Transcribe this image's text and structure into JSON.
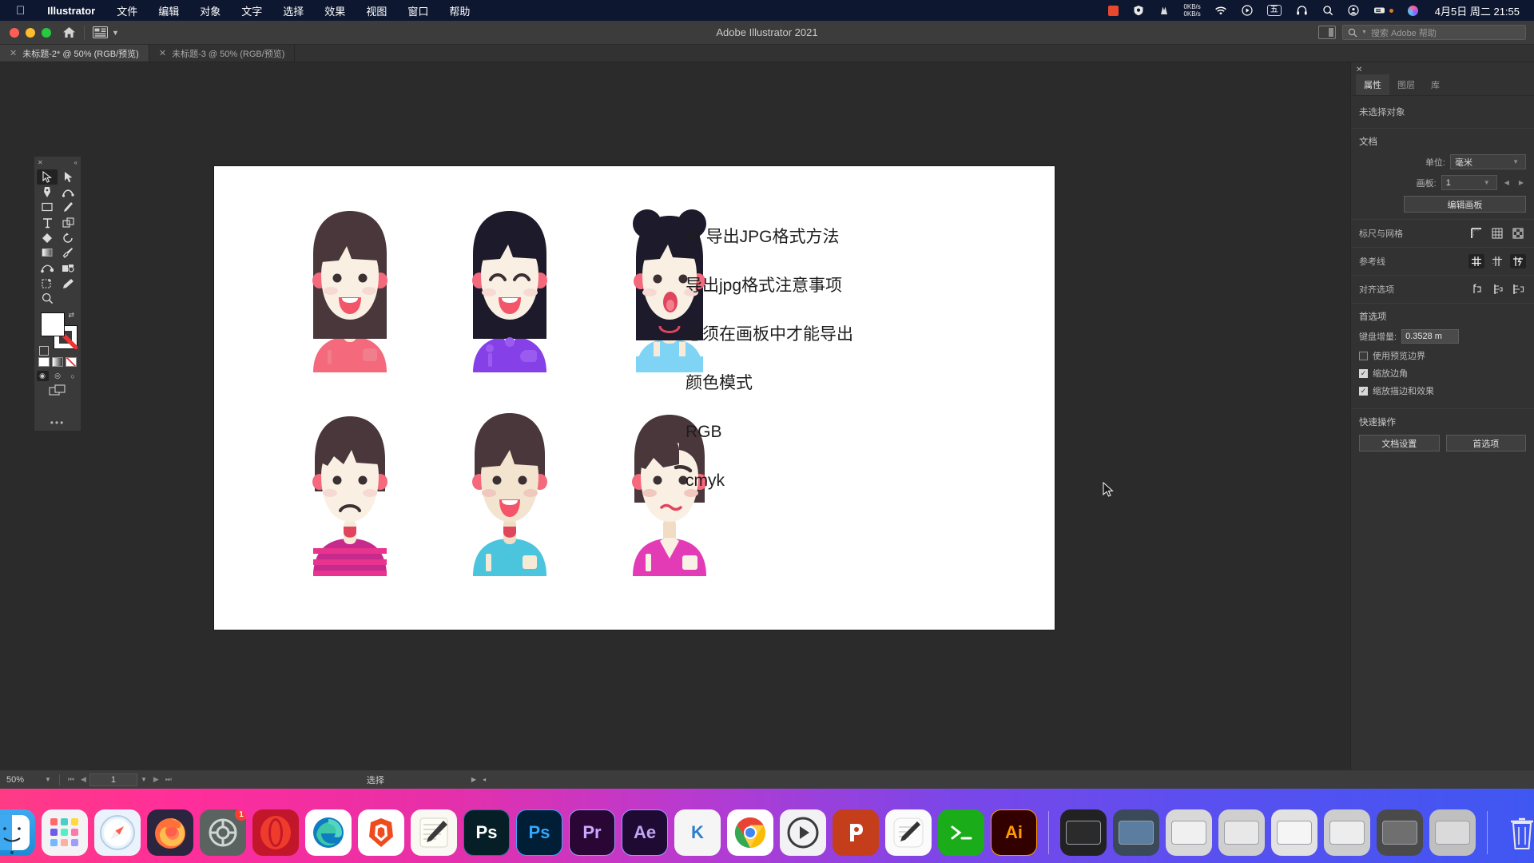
{
  "menubar": {
    "apple_icon": "apple-icon",
    "app_name": "Illustrator",
    "items": [
      "文件",
      "编辑",
      "对象",
      "文字",
      "选择",
      "效果",
      "视图",
      "窗口",
      "帮助"
    ],
    "status_icons": [
      "red-square-icon",
      "shield-icon",
      "mountain-icon"
    ],
    "network_up": "0KB/s",
    "network_down": "0KB/s",
    "right_icons": [
      "wifi-icon",
      "play-circle-icon",
      "ime-chinese-icon",
      "headphones-icon",
      "search-icon",
      "control-center-icon",
      "battery-icon",
      "siri-icon"
    ],
    "ime_label": "五",
    "clock": "4月5日 周二  21:55"
  },
  "titlebar": {
    "title": "Adobe Illustrator 2021",
    "home_icon": "home-icon",
    "arrange_icon": "arrange-documents-icon",
    "chevron_icon": "chevron-down-icon",
    "panel_toggle_icon": "panel-toggle-icon",
    "search_icon": "search-icon",
    "search_placeholder": "搜索 Adobe 帮助"
  },
  "tabs": [
    {
      "label": "未标题-2* @ 50% (RGB/预览)",
      "active": true,
      "close_icon": "close-icon"
    },
    {
      "label": "未标题-3 @ 50% (RGB/预览)",
      "active": false,
      "close_icon": "close-icon"
    }
  ],
  "toolbar": {
    "close_icon": "close-icon",
    "collapse_icon": "collapse-panel-icon",
    "tools": [
      "selection-tool",
      "direct-selection-tool",
      "pen-tool",
      "curvature-tool",
      "rectangle-tool",
      "paintbrush-tool",
      "type-tool",
      "shape-builder-tool",
      "eraser-tool",
      "rotate-tool",
      "gradient-tool",
      "eyedropper-tool",
      "blend-tool",
      "perspective-grid-tool",
      "artboard-tool",
      "pencil-tool",
      "zoom-tool"
    ],
    "fill_color": "#ffffff",
    "stroke_color": "#ffffff",
    "swap_icon": "swap-fill-stroke-icon",
    "default_icon": "default-fill-stroke-icon",
    "modes": [
      "color-mode",
      "gradient-mode",
      "none-mode"
    ],
    "draw_modes": [
      "draw-normal",
      "draw-behind",
      "draw-inside"
    ],
    "screen_mode_icon": "screen-mode-icon",
    "more_icon": "more-tools-icon"
  },
  "canvas": {
    "text_lines": [
      "AI 导出JPG格式方法",
      "导出jpg格式注意事项",
      "必须在画板中才能导出",
      "颜色模式",
      "RGB",
      "cmyk"
    ],
    "avatars": [
      {
        "name": "girl-long-brown-hair-pink-shirt",
        "hair": "#4a373b",
        "skin": "#f9f0e3",
        "shirt": "#f4697b"
      },
      {
        "name": "girl-black-hair-purple-shirt",
        "hair": "#1d1b2b",
        "skin": "#f9f0e3",
        "shirt": "#8540e8"
      },
      {
        "name": "girl-buns-blue-overall",
        "hair": "#1d1b2b",
        "skin": "#f9f0e3",
        "shirt": "#7fd4f5"
      },
      {
        "name": "boy-sad-striped-shirt",
        "hair": "#4a373b",
        "skin": "#f9f0e3",
        "shirt": "#c62a8c"
      },
      {
        "name": "boy-happy-cyan-shirt",
        "hair": "#4a373b",
        "skin": "#f3e4d0",
        "shirt": "#4bc4dd"
      },
      {
        "name": "boy-worried-magenta-shirt",
        "hair": "#4a373b",
        "skin": "#f9f0e3",
        "shirt": "#e33bb6"
      }
    ]
  },
  "properties": {
    "close_icon": "close-icon",
    "tabs": [
      {
        "label": "属性",
        "active": true
      },
      {
        "label": "图层",
        "active": false
      },
      {
        "label": "库",
        "active": false
      }
    ],
    "no_selection": "未选择对象",
    "document": {
      "heading": "文档",
      "unit_label": "单位:",
      "unit_value": "毫米",
      "artboard_label": "画板:",
      "artboard_value": "1",
      "edit_artboard_button": "编辑画板",
      "prev_icon": "prev-artboard-icon",
      "next_icon": "next-artboard-icon",
      "chevron_icon": "chevron-down-icon"
    },
    "rulers": {
      "label": "标尺与网格",
      "icons": [
        "show-rulers-icon",
        "show-grid-icon",
        "show-transparency-grid-icon"
      ]
    },
    "guides": {
      "label": "参考线",
      "icons": [
        "show-guides-icon",
        "lock-guides-icon",
        "smart-guides-icon"
      ],
      "active_index": 2
    },
    "align": {
      "label": "对齐选项",
      "icons": [
        "align-pixel-grid-icon",
        "snap-to-point-icon",
        "snap-to-grid-icon"
      ]
    },
    "preferences": {
      "heading": "首选项",
      "keyboard_increment_label": "键盘增量:",
      "keyboard_increment_value": "0.3528 m",
      "checkboxes": [
        {
          "label": "使用预览边界",
          "checked": false
        },
        {
          "label": "缩放边角",
          "checked": true
        },
        {
          "label": "缩放描边和效果",
          "checked": true
        }
      ]
    },
    "quick_actions": {
      "heading": "快速操作",
      "buttons": [
        "文档设置",
        "首选项"
      ]
    }
  },
  "statusbar": {
    "zoom": "50%",
    "zoom_chevron_icon": "chevron-down-icon",
    "first_icon": "first-artboard-icon",
    "prev_icon": "prev-artboard-icon",
    "artboard_number": "1",
    "artboard_chevron_icon": "chevron-down-icon",
    "next_icon": "next-artboard-icon",
    "last_icon": "last-artboard-icon",
    "tool_status": "选择",
    "play_icon": "play-icon",
    "resize_icon": "resize-grip-icon"
  },
  "dock": {
    "items": [
      {
        "name": "finder",
        "label": "",
        "bg": "#2b9fe8",
        "glyph": "finder-icon"
      },
      {
        "name": "launchpad",
        "label": "",
        "bg": "#f2f2f4",
        "glyph": "launchpad-icon"
      },
      {
        "name": "safari",
        "label": "",
        "bg": "#eef4fa",
        "glyph": "safari-icon"
      },
      {
        "name": "firefox",
        "label": "",
        "bg": "#2a2a35",
        "glyph": "firefox-icon"
      },
      {
        "name": "settings",
        "label": "",
        "bg": "#4a4f4a",
        "glyph": "gear-icon",
        "badge": "1"
      },
      {
        "name": "opera",
        "label": "",
        "bg": "#ef3b2c",
        "glyph": "opera-icon"
      },
      {
        "name": "edge",
        "label": "",
        "bg": "#ffffff",
        "glyph": "edge-icon"
      },
      {
        "name": "brave",
        "label": "",
        "bg": "#ffffff",
        "glyph": "brave-icon"
      },
      {
        "name": "notes",
        "label": "",
        "bg": "#f7f5ef",
        "glyph": "notes-icon"
      },
      {
        "name": "photoshop-dark",
        "label": "Ps",
        "bg": "#061e26",
        "glyph": "ps-icon"
      },
      {
        "name": "photoshop",
        "label": "Ps",
        "bg": "#001e36",
        "glyph": "ps-icon"
      },
      {
        "name": "premiere",
        "label": "Pr",
        "bg": "#2a0634",
        "glyph": "pr-icon"
      },
      {
        "name": "after-effects",
        "label": "Ae",
        "bg": "#1f0a33",
        "glyph": "ae-icon"
      },
      {
        "name": "keyshot",
        "label": "K",
        "bg": "#f5f5f5",
        "glyph": "k-icon"
      },
      {
        "name": "chrome",
        "label": "",
        "bg": "#ffffff",
        "glyph": "chrome-icon"
      },
      {
        "name": "iina",
        "label": "",
        "bg": "#f0f0f2",
        "glyph": "iina-icon"
      },
      {
        "name": "powerpoint",
        "label": "P",
        "bg": "#c43e1c",
        "glyph": "ppt-icon"
      },
      {
        "name": "ulysses",
        "label": "",
        "bg": "#fbfbfb",
        "glyph": "ulysses-icon"
      },
      {
        "name": "wechat-dev",
        "label": "",
        "bg": "#1aad19",
        "glyph": "wechat-icon"
      },
      {
        "name": "illustrator",
        "label": "Ai",
        "bg": "#330000",
        "glyph": "ai-icon"
      }
    ],
    "minimized": [
      {
        "name": "window-preview-1"
      },
      {
        "name": "window-preview-2"
      },
      {
        "name": "window-preview-3"
      },
      {
        "name": "window-preview-4"
      },
      {
        "name": "window-preview-5"
      },
      {
        "name": "window-preview-6"
      },
      {
        "name": "window-preview-7"
      },
      {
        "name": "window-preview-8"
      }
    ],
    "trash": "trash-icon"
  }
}
